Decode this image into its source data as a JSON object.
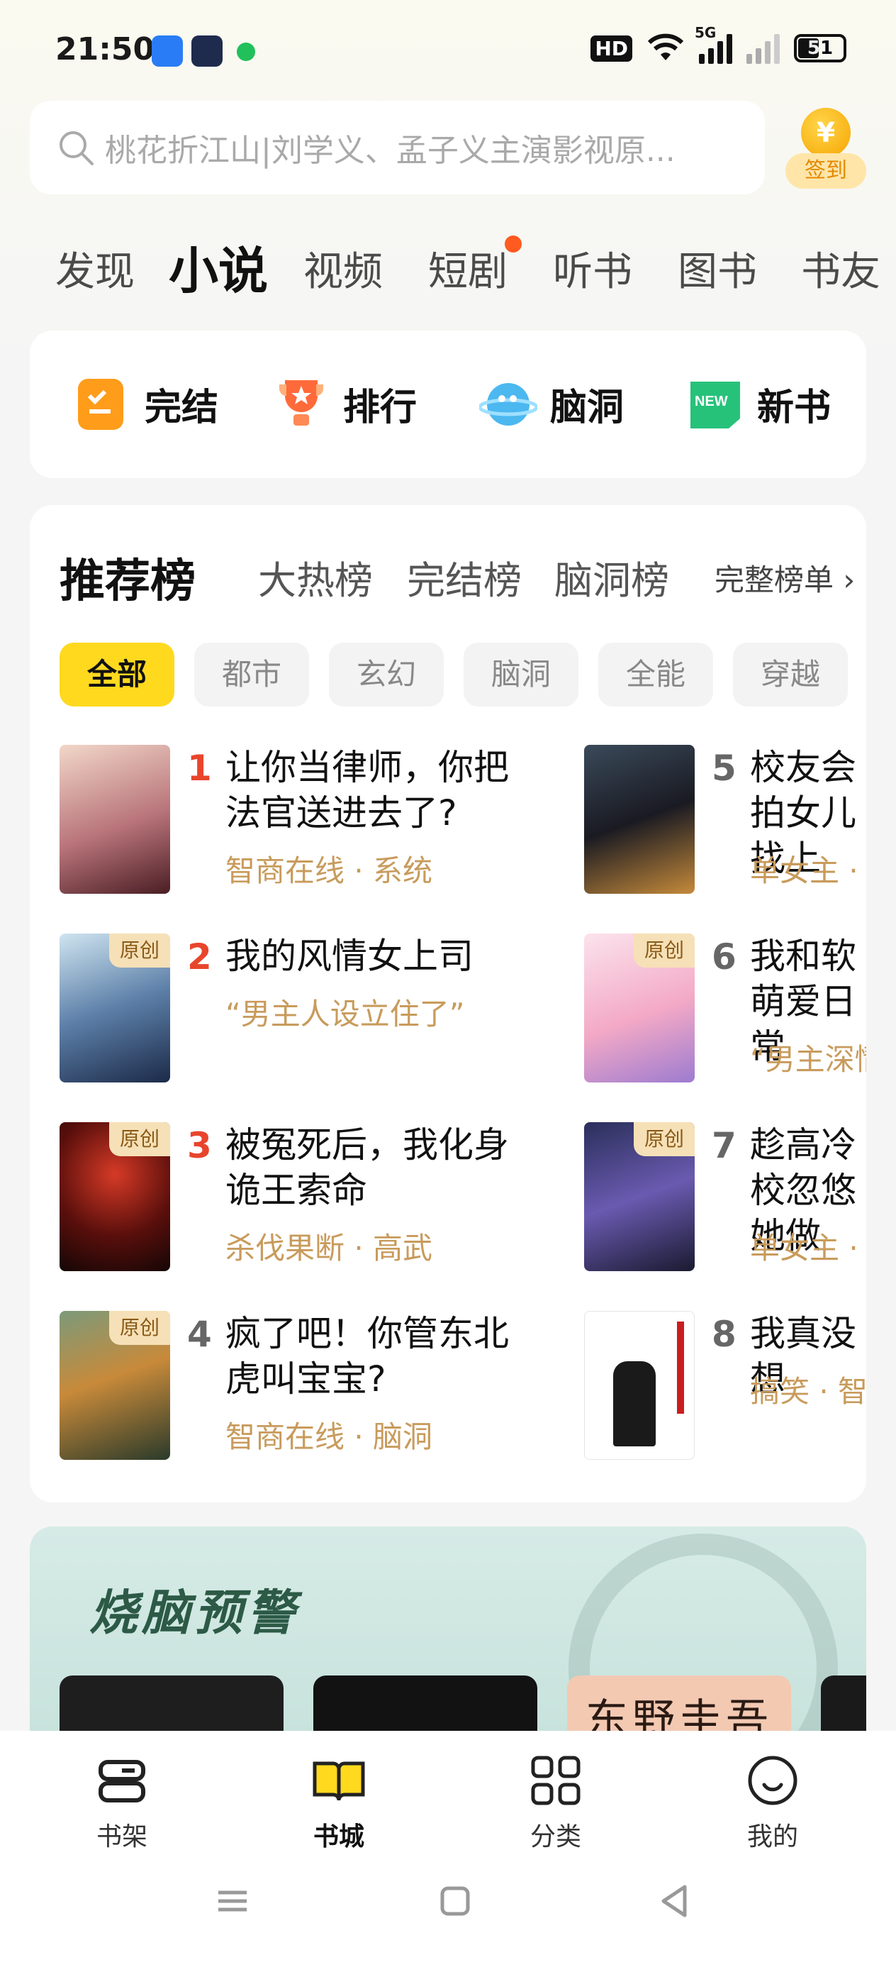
{
  "status": {
    "time": "21:50",
    "hd": "HD",
    "battery": "51",
    "net": "5G"
  },
  "search": {
    "placeholder": "桃花折江山|刘学义、孟子义主演影视原...",
    "checkin_label": "签到",
    "coin": "¥"
  },
  "tabs": [
    "发现",
    "小说",
    "视频",
    "短剧",
    "听书",
    "图书",
    "书友"
  ],
  "active_tab": "小说",
  "shortcuts": [
    {
      "label": "完结",
      "icon": "completed-icon"
    },
    {
      "label": "排行",
      "icon": "trophy-icon"
    },
    {
      "label": "脑洞",
      "icon": "planet-icon"
    },
    {
      "label": "新书",
      "icon": "new-badge-icon",
      "badge": "NEW"
    }
  ],
  "ranking": {
    "tabs": [
      "推荐榜",
      "大热榜",
      "完结榜",
      "脑洞榜"
    ],
    "more": "完整榜单 ›",
    "chips": [
      "全部",
      "都市",
      "玄幻",
      "脑洞",
      "全能",
      "穿越"
    ],
    "original_badge": "原创",
    "books": [
      {
        "rank": "1",
        "title": "让你当律师，你把法官送进去了?",
        "tags": "智商在线 · 系统",
        "original": false
      },
      {
        "rank": "2",
        "title": "我的风情女上司",
        "tags": "“男主人设立住了”",
        "original": true
      },
      {
        "rank": "3",
        "title": "被冤死后，我化身诡王索命",
        "tags": "杀伐果断 · 高武",
        "original": true
      },
      {
        "rank": "4",
        "title": "疯了吧！你管东北虎叫宝宝?",
        "tags": "智商在线 · 脑洞",
        "original": true
      },
      {
        "rank": "5",
        "title": "校友会拍女儿找上",
        "tags": "单女主 ·",
        "original": false
      },
      {
        "rank": "6",
        "title": "我和软萌爱日常",
        "tags": "“男主深情",
        "original": true
      },
      {
        "rank": "7",
        "title": "趁高冷校忽悠她做",
        "tags": "单女主 ·",
        "original": true
      },
      {
        "rank": "8",
        "title": "我真没想",
        "tags": "搞笑 · 智",
        "original": false
      }
    ]
  },
  "banner": {
    "title": "烧脑预警",
    "card_text": "东野圭吾"
  },
  "bottom_nav": [
    {
      "label": "书架",
      "icon": "bookshelf-icon"
    },
    {
      "label": "书城",
      "icon": "open-book-icon"
    },
    {
      "label": "分类",
      "icon": "grid-icon"
    },
    {
      "label": "我的",
      "icon": "smiley-profile-icon"
    }
  ],
  "colors": {
    "accent": "#ffd91e",
    "rank_red": "#e8452c",
    "rank_gray": "#666666",
    "tag": "#c89b5c"
  }
}
